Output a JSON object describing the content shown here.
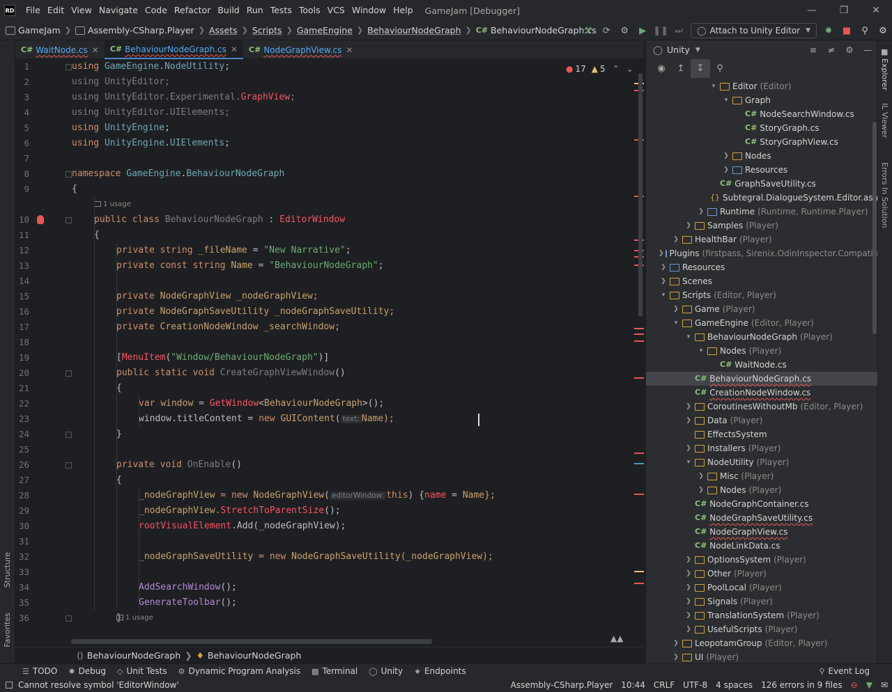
{
  "app": {
    "logo": "RD",
    "title": "GameJam [Debugger]"
  },
  "menu": [
    "File",
    "Edit",
    "View",
    "Navigate",
    "Code",
    "Refactor",
    "Build",
    "Run",
    "Tests",
    "Tools",
    "VCS",
    "Window",
    "Help"
  ],
  "breadcrumb": [
    "GameJam",
    "Assembly-CSharp.Player",
    "Assets",
    "Scripts",
    "GameEngine",
    "BehaviourNodeGraph",
    "BehaviourNodeGraph.cs"
  ],
  "toolbar": {
    "attach_label": "Attach to Unity Editor"
  },
  "tabs": [
    {
      "label": "WaitNode.cs"
    },
    {
      "label": "BehaviourNodeGraph.cs"
    },
    {
      "label": "NodeGraphView.cs"
    }
  ],
  "editor": {
    "errors": "17",
    "warnings": "5",
    "usage1": "1 usage",
    "usage2": "1 usage",
    "hint_text": "text:",
    "hint_editor": "editorWindow:",
    "lines": [
      "1",
      "2",
      "3",
      "4",
      "5",
      "6",
      "7",
      "8",
      "9",
      "10",
      "11",
      "12",
      "13",
      "14",
      "15",
      "16",
      "17",
      "18",
      "19",
      "20",
      "21",
      "22",
      "23",
      "24",
      "25",
      "26",
      "27",
      "28",
      "29",
      "30",
      "31",
      "32",
      "33",
      "34",
      "35",
      "36"
    ]
  },
  "code": {
    "l1a": "using ",
    "l1b": "GameEngine",
    "l1c": ".",
    "l1d": "NodeUtility",
    "l1e": ";",
    "l2": "using UnityEditor;",
    "l3a": "using UnityEditor.Experimental.",
    "l3b": "GraphView",
    "l3c": ";",
    "l4": "using UnityEditor.UIElements;",
    "l5a": "using ",
    "l5b": "UnityEngine",
    "l5c": ";",
    "l6a": "using ",
    "l6b": "UnityEngine",
    "l6c": ".",
    "l6d": "UIElements",
    "l6e": ";",
    "l8a": "namespace ",
    "l8b": "GameEngine",
    "l8c": ".",
    "l8d": "BehaviourNodeGraph",
    "l9": "{",
    "l10a": "public class ",
    "l10b": "BehaviourNodeGraph",
    " l10c": " : ",
    "l10d": "EditorWindow",
    "l11": "{",
    "l12a": "private ",
    "l12b": "string ",
    "l12c": "_fileName",
    " l12d": " = ",
    "l12e": "\"New Narrative\"",
    "l12f": ";",
    "l13a": "private const ",
    "l13b": "string ",
    "l13c": "Name",
    " l13d": " = ",
    "l13e": "\"BehaviourNodeGraph\"",
    "l13f": ";",
    "l15a": "private ",
    "l15b": "NodeGraphView ",
    "l15c": "_nodeGraphView;",
    "l16a": "private ",
    "l16b": "NodeGraphSaveUtility ",
    "l16c": "_nodeGraphSaveUtility;",
    "l17a": "private ",
    "l17b": "CreationNodeWindow ",
    "l17c": "_searchWindow;",
    "l19a": "[",
    "l19b": "MenuItem",
    "l19c": "(",
    "l19d": "\"Window/BehaviourNodeGraph\"",
    "l19e": ")]",
    "l20a": "public static void ",
    "l20b": "CreateGraphViewWindow",
    "l20c": "()",
    "l21": "{",
    "l22a": "var ",
    "l22b": "window",
    " l22c": " = ",
    "l22d": "GetWindow",
    "l22e": "<",
    "l22f": "BehaviourNodeGraph",
    "l22g": ">();",
    "l23a": "window.titleContent = ",
    "l23b": "new ",
    "l23c": "GUIContent",
    "l23d": "(",
    "l23e": "Name);",
    "l24": "}",
    "l26a": "private void ",
    "l26b": "OnEnable",
    "l26c": "()",
    "l27": "{",
    "l28a": "_nodeGraphView = ",
    "l28b": "new ",
    "l28c": "NodeGraphView",
    "l28d": "(",
    "l28e": "this",
    ") {": ") {",
    "l28f": "name",
    " l28g": " = ",
    "l28h": "Name};",
    "l29a": "_nodeGraphView.",
    "l29b": "StretchToParentSize",
    "l29c": "();",
    "l30a": "rootVisualElement",
    ".Add": ".Add(_nodeGraphView);",
    "l32a": "_nodeGraphSaveUtility = ",
    "l32b": "new ",
    "l32c": "NodeGraphSaveUtility",
    "l32d": "(_nodeGraphView);",
    "l34a": "AddSearchWindow",
    "l34b": "();",
    "l35a": "GenerateToolbar",
    "l35b": "();",
    "l36": "}"
  },
  "editor_breadcrumb": [
    "BehaviourNodeGraph",
    "BehaviourNodeGraph"
  ],
  "unity_panel": {
    "title": "Unity"
  },
  "tree": [
    {
      "label": "Editor",
      "dim": "(Editor)"
    },
    {
      "label": "Graph",
      "dim": ""
    },
    {
      "label": "NodeSearchWindow.cs",
      "dim": ""
    },
    {
      "label": "StoryGraph.cs",
      "dim": ""
    },
    {
      "label": "StoryGraphView.cs",
      "dim": ""
    },
    {
      "label": "Nodes",
      "dim": ""
    },
    {
      "label": "Resources",
      "dim": ""
    },
    {
      "label": "GraphSaveUtility.cs",
      "dim": ""
    },
    {
      "label": "Subtegral.DialogueSystem.Editor.asmd",
      "dim": ""
    },
    {
      "label": "Runtime",
      "dim": "(Runtime, Runtime.Player)"
    },
    {
      "label": "Samples",
      "dim": "(Player)"
    },
    {
      "label": "HealthBar",
      "dim": "(Player)"
    },
    {
      "label": "Plugins",
      "dim": "(firstpass, Sirenix.OdinInspector.Compatibilit"
    },
    {
      "label": "Resources",
      "dim": ""
    },
    {
      "label": "Scenes",
      "dim": ""
    },
    {
      "label": "Scripts",
      "dim": "(Editor, Player)"
    },
    {
      "label": "Game",
      "dim": "(Player)"
    },
    {
      "label": "GameEngine",
      "dim": "(Editor, Player)"
    },
    {
      "label": "BehaviourNodeGraph",
      "dim": "(Player)"
    },
    {
      "label": "Nodes",
      "dim": "(Player)"
    },
    {
      "label": "WaitNode.cs",
      "dim": ""
    },
    {
      "label": "BehaviourNodeGraph.cs",
      "dim": ""
    },
    {
      "label": "CreationNodeWindow.cs",
      "dim": ""
    },
    {
      "label": "CoroutinesWithoutMb",
      "dim": "(Editor, Player)"
    },
    {
      "label": "Data",
      "dim": "(Player)"
    },
    {
      "label": "EffectsSystem",
      "dim": ""
    },
    {
      "label": "Installers",
      "dim": "(Player)"
    },
    {
      "label": "NodeUtility",
      "dim": "(Player)"
    },
    {
      "label": "Misc",
      "dim": "(Player)"
    },
    {
      "label": "Nodes",
      "dim": "(Player)"
    },
    {
      "label": "NodeGraphContainer.cs",
      "dim": ""
    },
    {
      "label": "NodeGraphSaveUtility.cs",
      "dim": ""
    },
    {
      "label": "NodeGraphView.cs",
      "dim": ""
    },
    {
      "label": "NodeLinkData.cs",
      "dim": ""
    },
    {
      "label": "OptionsSystem",
      "dim": "(Player)"
    },
    {
      "label": "Other",
      "dim": "(Player)"
    },
    {
      "label": "PoolLocal",
      "dim": "(Player)"
    },
    {
      "label": "Signals",
      "dim": "(Player)"
    },
    {
      "label": "TranslationSystem",
      "dim": "(Player)"
    },
    {
      "label": "UsefulScripts",
      "dim": "(Player)"
    },
    {
      "label": "LeopotamGroup",
      "dim": "(Editor, Player)"
    },
    {
      "label": "UI",
      "dim": "(Player)"
    }
  ],
  "side_strips": {
    "explorer": "Explorer",
    "ilviewer": "IL Viewer",
    "errors": "Errors In Solution",
    "structure": "Structure",
    "favorites": "Favorites"
  },
  "toolwindows": [
    "TODO",
    "Debug",
    "Unit Tests",
    "Dynamic Program Analysis",
    "Terminal",
    "Unity",
    "Endpoints",
    "Event Log"
  ],
  "status": {
    "message": "Cannot resolve symbol 'EditorWindow'",
    "project": "Assembly-CSharp.Player",
    "position": "10:44",
    "line_sep": "CRLF",
    "encoding": "UTF-8",
    "indent": "4 spaces",
    "errors": "126 errors in 9 files"
  },
  "colors": {
    "accent": "#4a88c7",
    "error": "#f75464",
    "folder": "#d6a33b"
  }
}
